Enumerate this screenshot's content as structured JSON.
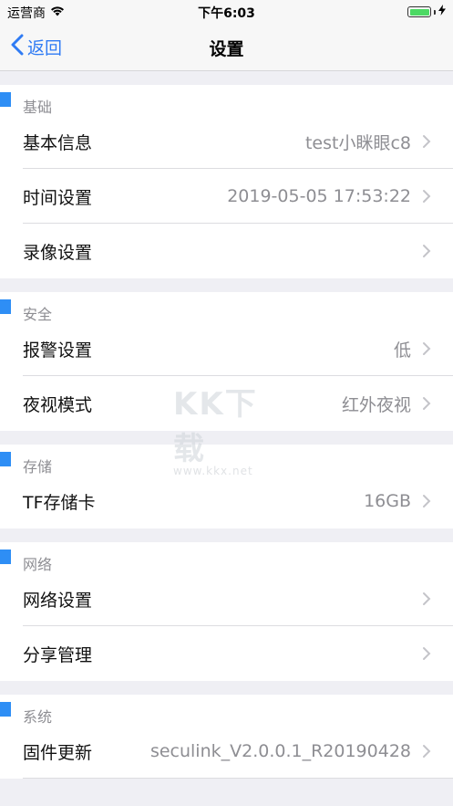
{
  "status_bar": {
    "carrier": "运营商",
    "time": "下午6:03"
  },
  "nav": {
    "back_label": "返回",
    "title": "设置"
  },
  "sections": [
    {
      "title": "基础",
      "rows": [
        {
          "label": "基本信息",
          "value": "test小眯眼c8"
        },
        {
          "label": "时间设置",
          "value": "2019-05-05 17:53:22"
        },
        {
          "label": "录像设置",
          "value": ""
        }
      ]
    },
    {
      "title": "安全",
      "rows": [
        {
          "label": "报警设置",
          "value": "低"
        },
        {
          "label": "夜视模式",
          "value": "红外夜视"
        }
      ]
    },
    {
      "title": "存储",
      "rows": [
        {
          "label": "TF存储卡",
          "value": "16GB"
        }
      ]
    },
    {
      "title": "网络",
      "rows": [
        {
          "label": "网络设置",
          "value": ""
        },
        {
          "label": "分享管理",
          "value": ""
        }
      ]
    },
    {
      "title": "系统",
      "rows": [
        {
          "label": "固件更新",
          "value": "seculink_V2.0.0.1_R20190428"
        }
      ]
    }
  ],
  "watermark": {
    "big": "KK下载",
    "small": "www.kkx.net"
  },
  "colors": {
    "accent": "#2f7bf4",
    "section_marker": "#2e8ef5",
    "battery": "#4cd964"
  }
}
